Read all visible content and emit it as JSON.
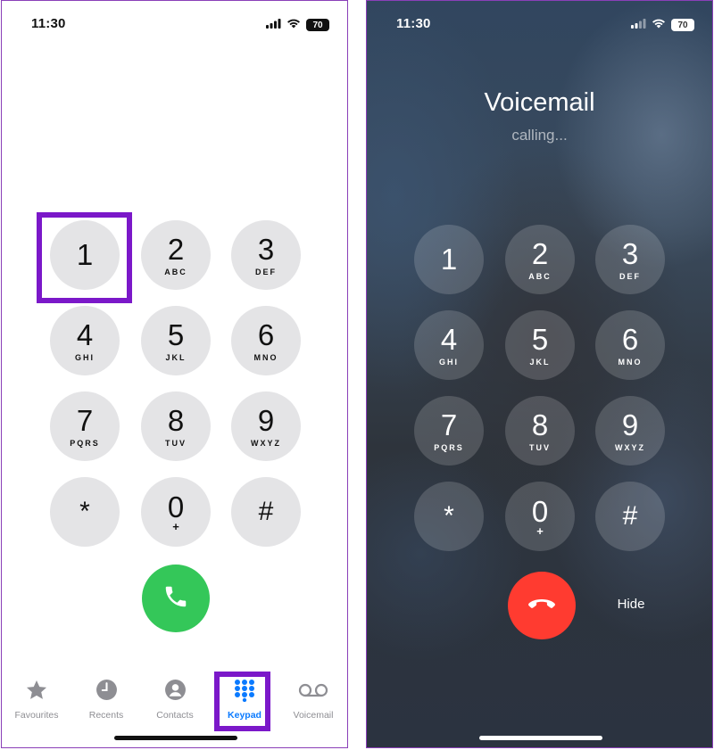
{
  "status_bar": {
    "time": "11:30",
    "battery": "70"
  },
  "keypad": [
    {
      "digit": "1",
      "letters": ""
    },
    {
      "digit": "2",
      "letters": "ABC"
    },
    {
      "digit": "3",
      "letters": "DEF"
    },
    {
      "digit": "4",
      "letters": "GHI"
    },
    {
      "digit": "5",
      "letters": "JKL"
    },
    {
      "digit": "6",
      "letters": "MNO"
    },
    {
      "digit": "7",
      "letters": "PQRS"
    },
    {
      "digit": "8",
      "letters": "TUV"
    },
    {
      "digit": "9",
      "letters": "WXYZ"
    },
    {
      "digit": "*",
      "letters": ""
    },
    {
      "digit": "0",
      "letters": "+"
    },
    {
      "digit": "#",
      "letters": ""
    }
  ],
  "tabs": [
    {
      "label": "Favourites",
      "icon": "star-icon"
    },
    {
      "label": "Recents",
      "icon": "clock-icon"
    },
    {
      "label": "Contacts",
      "icon": "person-icon"
    },
    {
      "label": "Keypad",
      "icon": "keypad-icon",
      "active": true
    },
    {
      "label": "Voicemail",
      "icon": "voicemail-icon"
    }
  ],
  "calling_screen": {
    "callee": "Voicemail",
    "status": "calling...",
    "hide_label": "Hide"
  },
  "colors": {
    "highlight": "#7b18c9",
    "call_green": "#34c759",
    "end_red": "#ff3b30",
    "active_tab": "#0a7aff"
  }
}
